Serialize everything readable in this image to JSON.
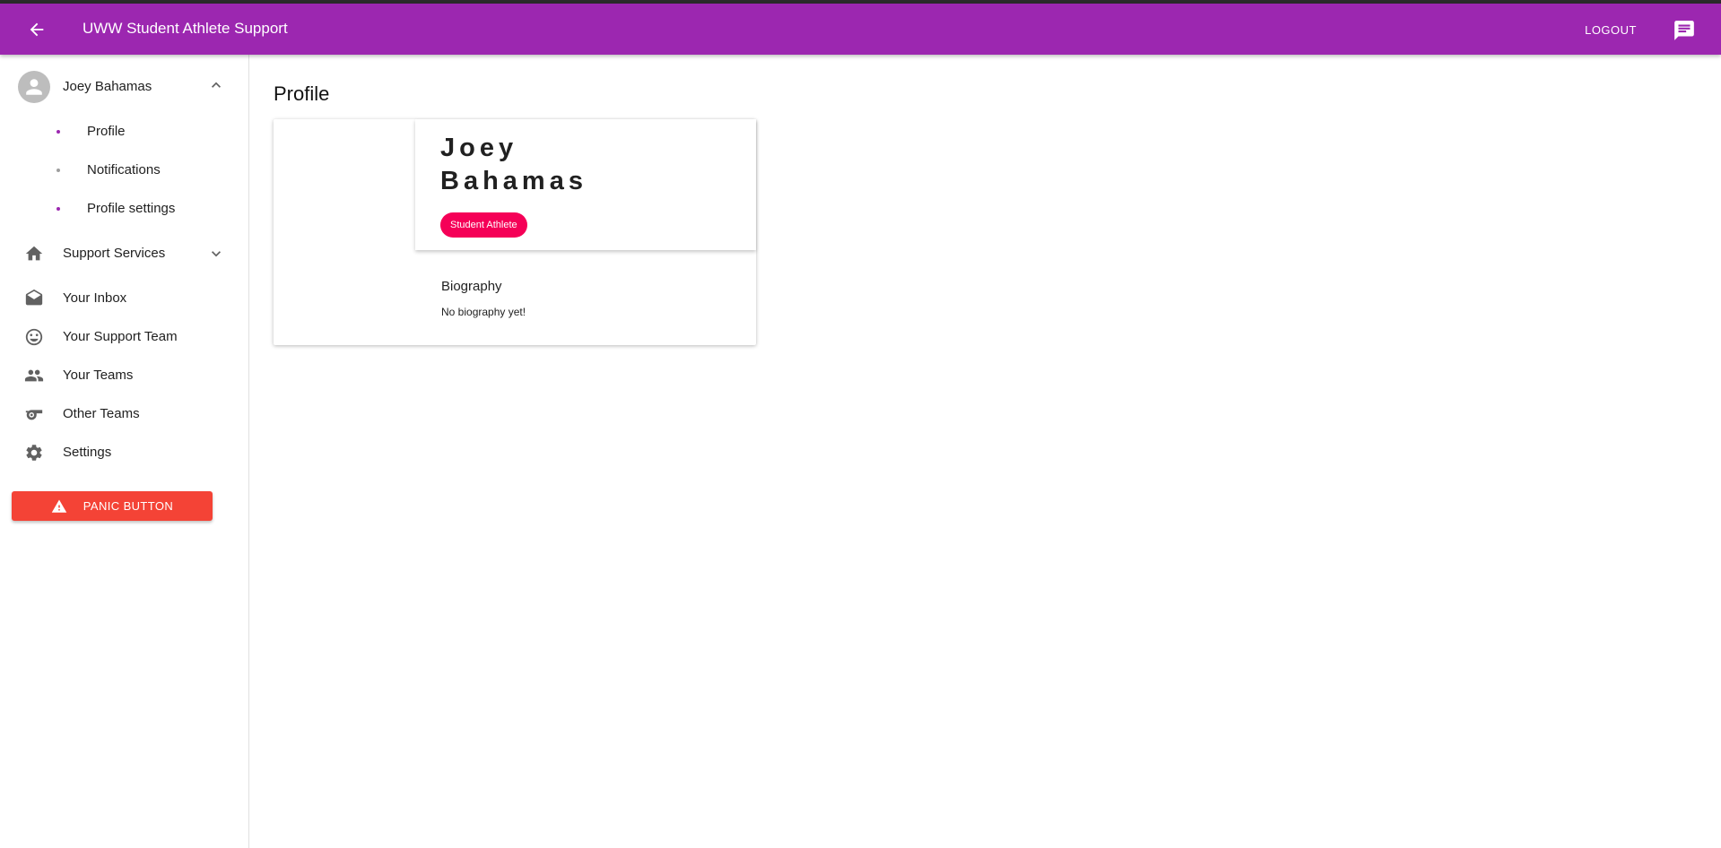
{
  "appbar": {
    "title": "UWW Student Athlete Support",
    "logout_label": "LOGOUT",
    "back_icon": "arrow-back-icon",
    "chat_icon": "chat-icon",
    "color": "#9c27b0"
  },
  "sidebar": {
    "user": {
      "name": "Joey Bahamas",
      "icon": "account-circle-icon",
      "expanded": true
    },
    "user_items": [
      {
        "label": "Profile",
        "dot_color": "#9c27b0"
      },
      {
        "label": "Notifications",
        "dot_color": "#9e9e9e"
      },
      {
        "label": "Profile settings",
        "dot_color": "#9c27b0"
      }
    ],
    "nav_items": [
      {
        "label": "Support Services",
        "icon": "home-icon",
        "expandable": true
      },
      {
        "label": "Your Inbox",
        "icon": "drafts-icon"
      },
      {
        "label": "Your Support Team",
        "icon": "smiley-icon"
      },
      {
        "label": "Your Teams",
        "icon": "people-icon"
      },
      {
        "label": "Other Teams",
        "icon": "whistle-icon"
      },
      {
        "label": "Settings",
        "icon": "gear-icon"
      }
    ],
    "panic_button": {
      "label": "PANIC BUTTON",
      "icon": "warning-icon",
      "color": "#f44336"
    }
  },
  "main": {
    "title": "Profile",
    "card": {
      "name_line1": "Joey",
      "name_line2": "Bahamas",
      "role_chip": "Student Athlete",
      "chip_color": "#f50057",
      "bio_title": "Biography",
      "bio_text": "No biography yet!"
    }
  }
}
